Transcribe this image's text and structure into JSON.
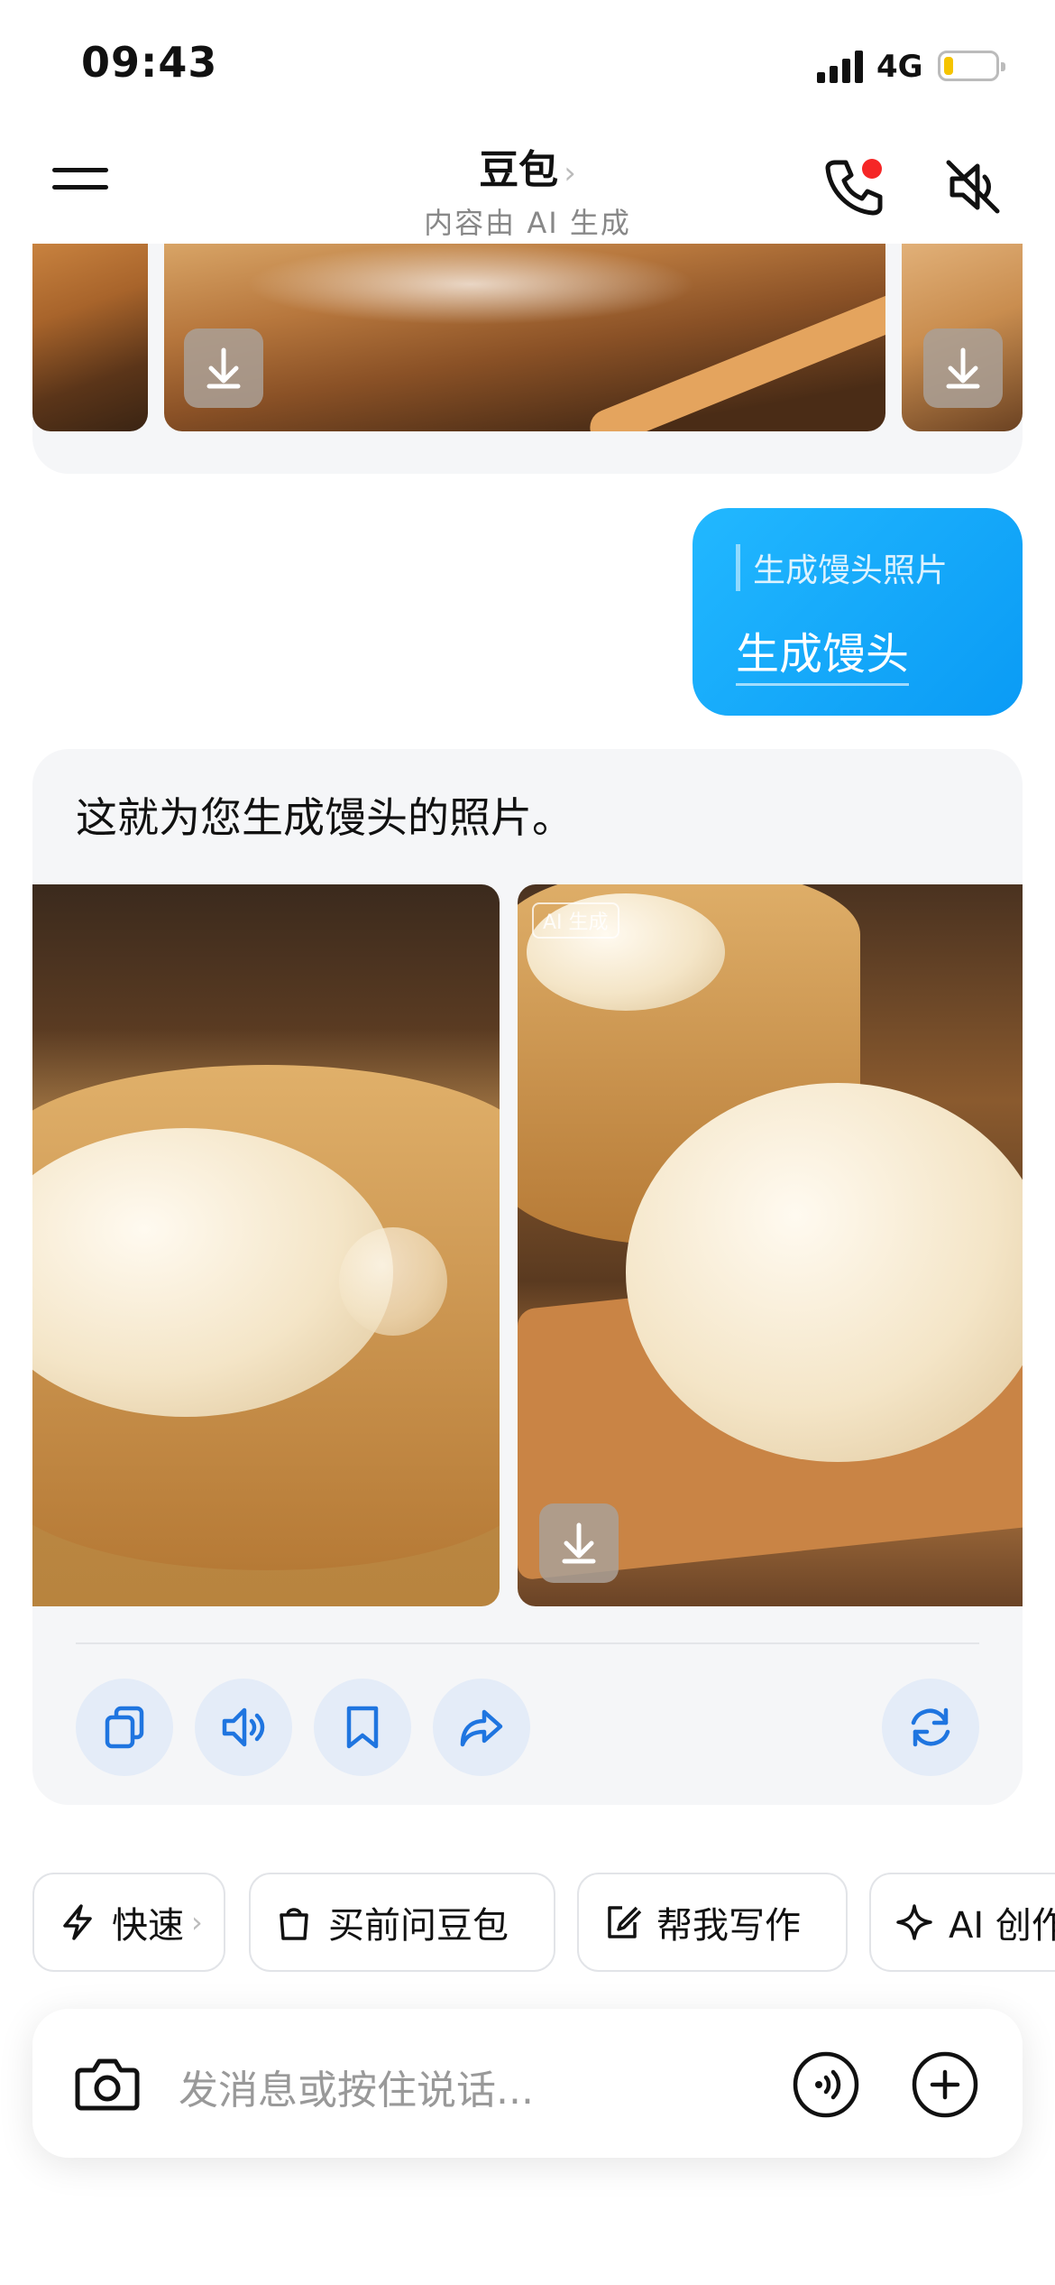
{
  "status_bar": {
    "time": "09:43",
    "network": "4G"
  },
  "header": {
    "title": "豆包",
    "title_chevron": "›",
    "subtitle": "内容由 AI 生成",
    "menu_icon": "menu-icon",
    "call_icon": "phone-icon",
    "mute_icon": "speaker-mute-icon"
  },
  "user_message": {
    "quoted": "生成馒头照片",
    "text": "生成馒头"
  },
  "assistant_message": {
    "text": "这就为您生成馒头的照片。",
    "image_badge": "AI 生成",
    "actions": [
      "copy-icon",
      "speaker-icon",
      "bookmark-icon",
      "share-icon",
      "regenerate-icon"
    ]
  },
  "quick_actions": [
    {
      "label": "快速",
      "icon": "bolt-icon",
      "chevron": "›"
    },
    {
      "label": "买前问豆包",
      "icon": "shopping-bag-icon"
    },
    {
      "label": "帮我写作",
      "icon": "edit-icon"
    },
    {
      "label": "AI 创作",
      "icon": "sparkle-icon"
    }
  ],
  "input": {
    "placeholder": "发消息或按住说话..."
  },
  "colors": {
    "accent": "#0a9bf5",
    "action_bg": "#e4ecf8",
    "icon_blue": "#1f75e0",
    "card_bg": "#f5f6f8"
  }
}
